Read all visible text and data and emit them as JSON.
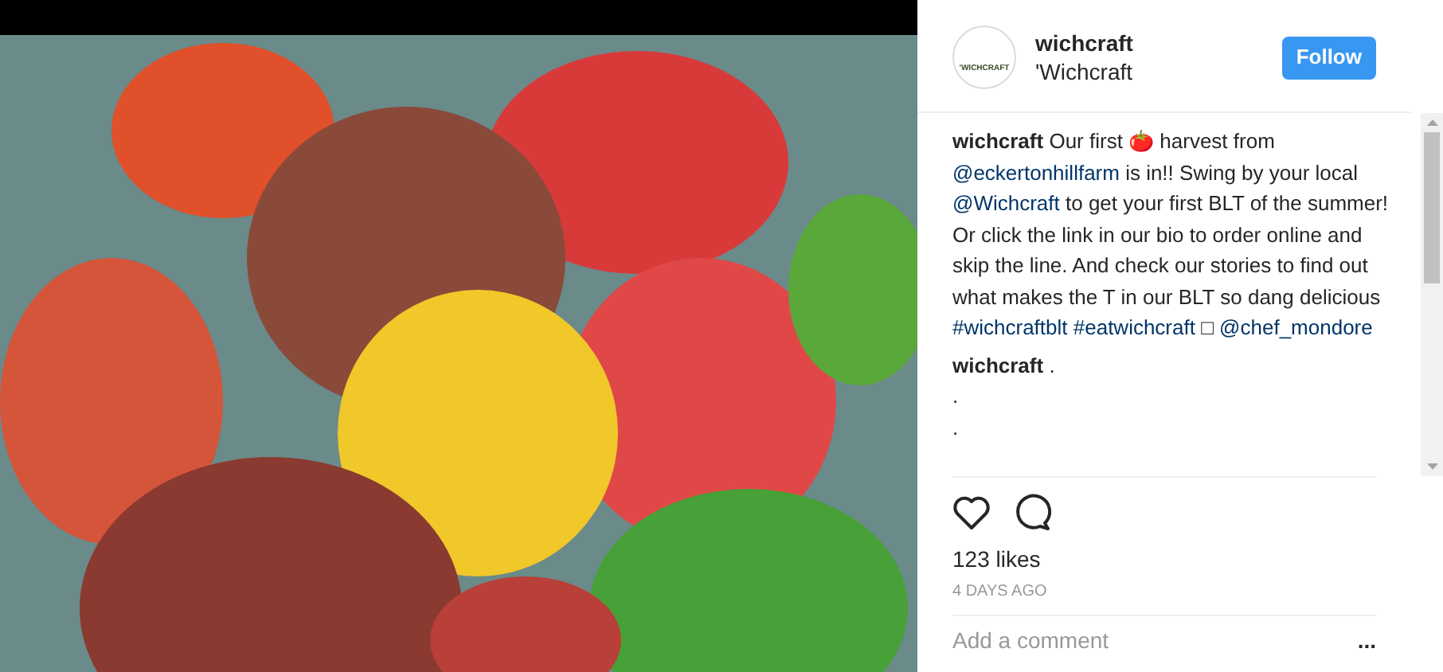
{
  "header": {
    "avatar_text": "'WICHCRAFT",
    "username": "wichcraft",
    "location": "'Wichcraft",
    "follow_button": "Follow"
  },
  "caption": {
    "username": "wichcraft",
    "segments": [
      {
        "kind": "text",
        "text": "Our first 🍅 harvest from "
      },
      {
        "kind": "link",
        "text": "@eckertonhillfarm"
      },
      {
        "kind": "text",
        "text": " is in!! Swing by your local "
      },
      {
        "kind": "link",
        "text": "@Wichcraft"
      },
      {
        "kind": "text",
        "text": " to get your first BLT of the summer! Or click the link in our bio to order online and skip the line. And check our stories to find out what makes the T in our BLT so dang delicious "
      },
      {
        "kind": "link",
        "text": "#wichcraftblt"
      },
      {
        "kind": "link",
        "text": "#eatwichcraft"
      },
      {
        "kind": "text",
        "text": " □ "
      },
      {
        "kind": "link",
        "text": "@chef_mondore"
      }
    ]
  },
  "comments": [
    {
      "username": "wichcraft",
      "text": ".",
      "lines": [
        ".",
        "."
      ]
    }
  ],
  "likes": "123 likes",
  "time": "4 DAYS AGO",
  "comment_field": {
    "placeholder": "Add a comment",
    "more": "..."
  }
}
